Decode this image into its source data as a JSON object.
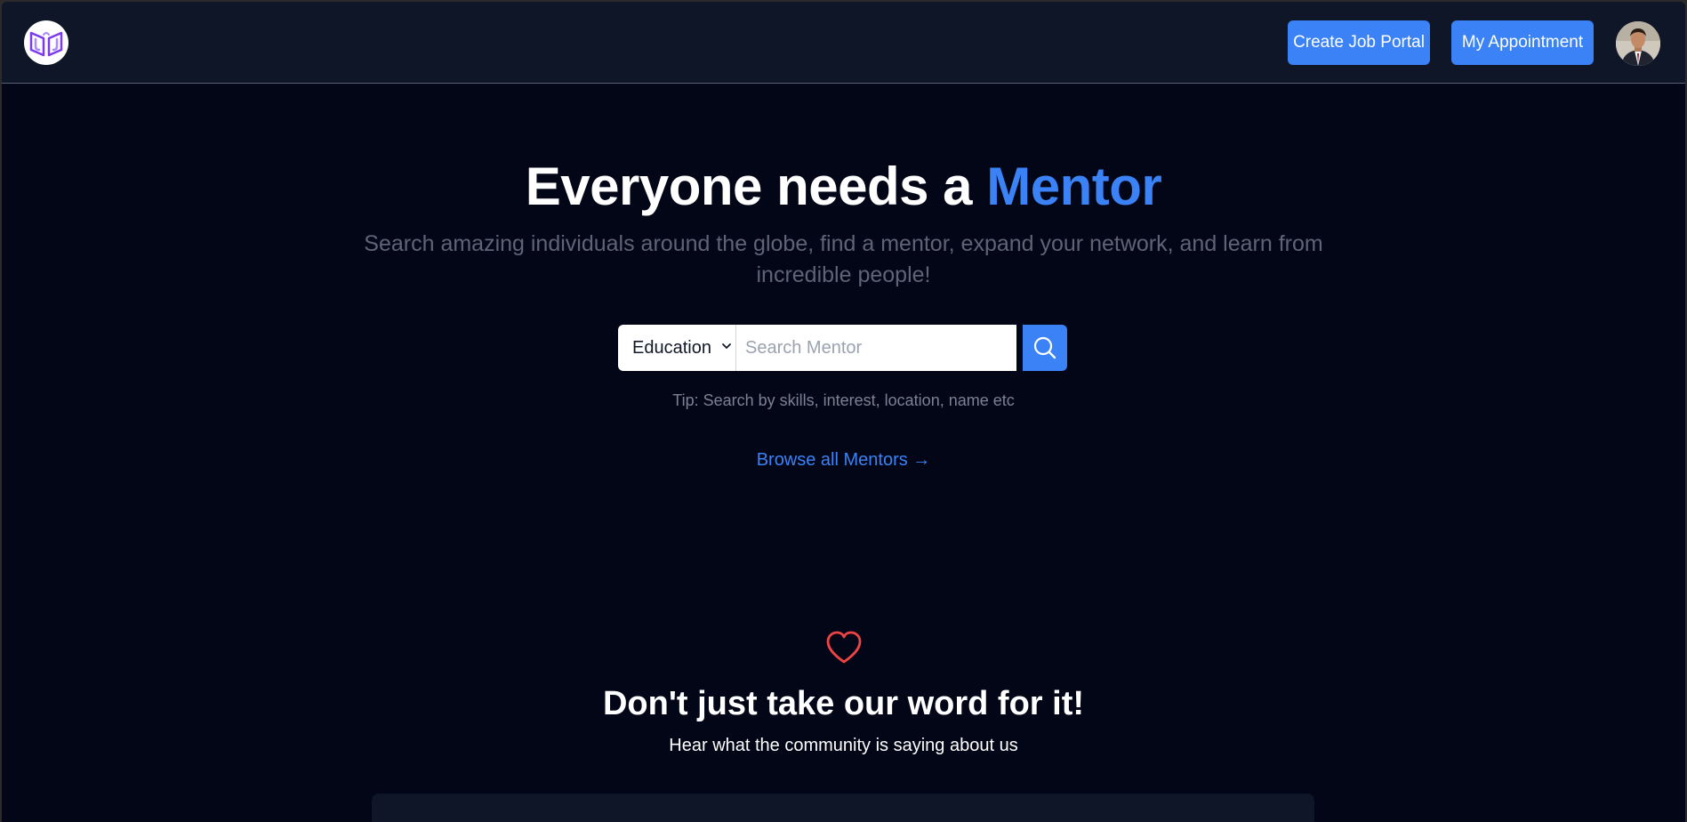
{
  "header": {
    "logo_icon": "book-u-logo-icon",
    "create_job_portal_label": "Create Job Portal",
    "my_appointment_label": "My Appointment",
    "avatar_icon": "user-avatar"
  },
  "hero": {
    "title_prefix": "Everyone needs a ",
    "title_accent": "Mentor",
    "subtitle": "Search amazing individuals around the globe, find a mentor, expand your network, and learn from incredible people!"
  },
  "search": {
    "category_selected": "Education",
    "placeholder": "Search Mentor",
    "value": "",
    "button_icon": "search-icon",
    "tip": "Tip: Search by skills, interest, location, name etc"
  },
  "browse_link": "Browse all Mentors →",
  "testimonials": {
    "icon": "heart-icon",
    "title": "Don't just take our word for it!",
    "subtitle": "Hear what the community is saying about us"
  },
  "colors": {
    "accent": "#3b82f6",
    "background": "#030617",
    "header_bg": "#0e1628",
    "heart": "#ef4444"
  }
}
